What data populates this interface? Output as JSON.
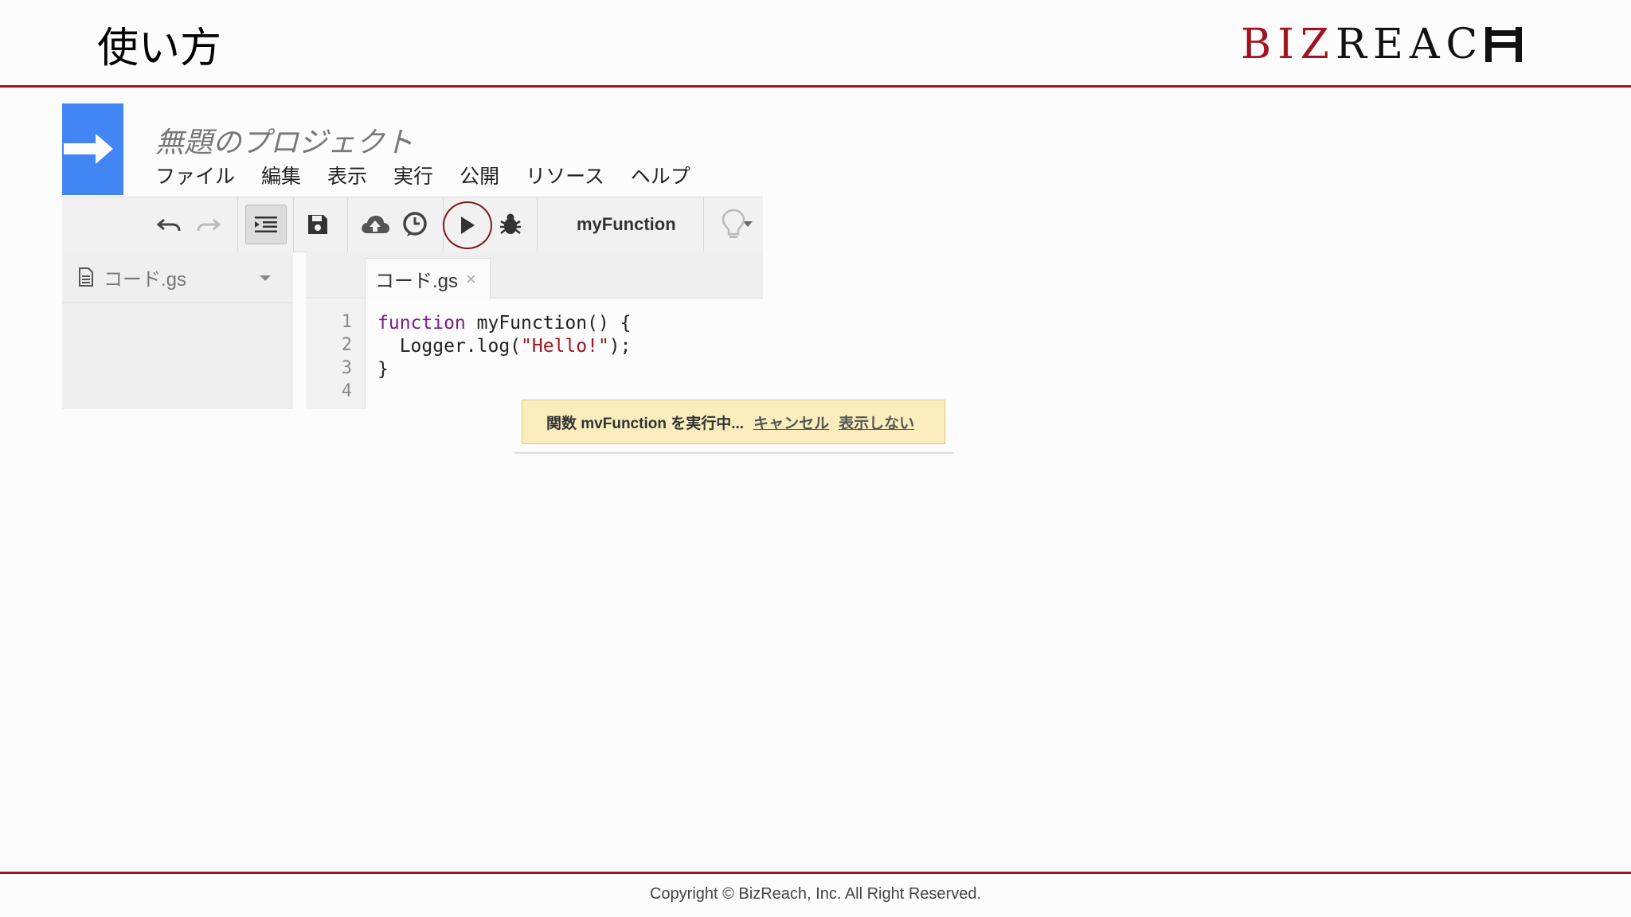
{
  "slide": {
    "title": "使い方",
    "logo_biz": "BIZ",
    "logo_reach": "REAC",
    "footer": "Copyright © BizReach, Inc. All Right Reserved."
  },
  "editor": {
    "project_title": "無題のプロジェクト",
    "menu": [
      "ファイル",
      "編集",
      "表示",
      "実行",
      "公開",
      "リソース",
      "ヘルプ"
    ],
    "toolbar": {
      "function_select": "myFunction",
      "icons": [
        "undo-icon",
        "redo-icon",
        "indent-icon",
        "save-icon",
        "cloud-upload-icon",
        "clock-icon",
        "run-icon",
        "bug-icon",
        "lightbulb-icon"
      ]
    },
    "sidebar": {
      "file_name": "コード.gs"
    },
    "tab": {
      "label": "コード.gs",
      "close": "×"
    },
    "code": {
      "line_numbers": [
        "1",
        "2",
        "3",
        "4"
      ],
      "lines": [
        {
          "kw": "function",
          "rest": " myFunction() {"
        },
        {
          "pre": "  Logger.log(",
          "str": "\"Hello!\"",
          "post": ");"
        },
        {
          "plain": "}"
        },
        {
          "plain": ""
        }
      ]
    },
    "toast": {
      "message": "関数 mvFunction を実行中...",
      "cancel": "キャンセル",
      "dismiss": "表示しない"
    }
  },
  "colors": {
    "accent": "#a11420",
    "app_icon": "#4285f4",
    "toast_bg": "#f9edbe"
  }
}
